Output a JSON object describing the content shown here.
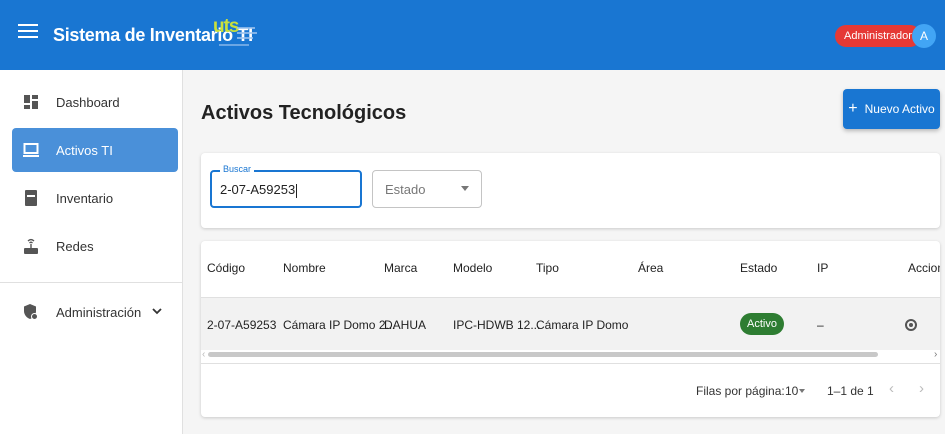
{
  "app": {
    "title": "Sistema de Inventario TI",
    "logo_text": "uts",
    "role_badge": "Administrador",
    "avatar_initial": "A"
  },
  "sidebar": {
    "items": [
      {
        "label": "Dashboard",
        "icon": "dashboard-icon"
      },
      {
        "label": "Activos TI",
        "icon": "computer-icon",
        "active": true
      },
      {
        "label": "Inventario",
        "icon": "inventory-icon"
      },
      {
        "label": "Redes",
        "icon": "router-icon"
      },
      {
        "label": "Administración",
        "icon": "admin-icon",
        "expand": "chevron-down-icon"
      }
    ],
    "chevron": "˅"
  },
  "main": {
    "title": "Activos Tecnológicos",
    "new_button_label": "Nuevo Activo",
    "new_button_icon": "+"
  },
  "filters": {
    "search_label": "Buscar",
    "search_value": "2-07-A59253",
    "status_placeholder": "Estado"
  },
  "table": {
    "columns": [
      "Código",
      "Nombre",
      "Marca",
      "Modelo",
      "Tipo",
      "Área",
      "Estado",
      "IP",
      "Acciones"
    ],
    "rows": [
      {
        "codigo": "2-07-A59253",
        "nombre": "Cámara IP Domo 2...",
        "marca": "DAHUA",
        "modelo": "IPC-HDWB 12...",
        "tipo": "Cámara IP Domo",
        "area": "",
        "estado": "Activo",
        "ip": "–"
      }
    ],
    "status_color": "#2e7d32"
  },
  "pagination": {
    "rows_per_page_label": "Filas por página:",
    "rows_per_page": "10",
    "range": "1–1 de 1",
    "prev": "‹",
    "next": "›"
  },
  "colors": {
    "primary": "#1976d2",
    "active_nav": "#4a90d9",
    "badge": "#e53935",
    "avatar": "#42a5f5"
  }
}
